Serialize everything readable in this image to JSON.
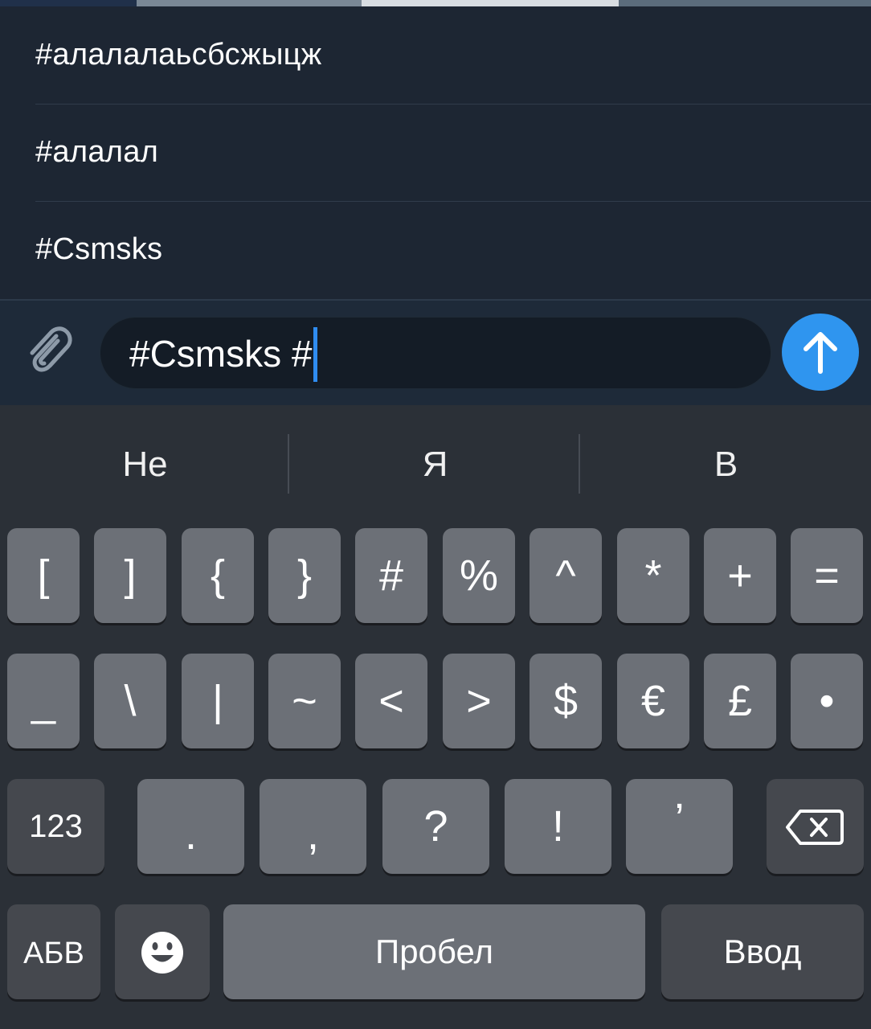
{
  "suggestions": [
    "#алалалаьсбсжыцж",
    "#алалал",
    "#Csmsks"
  ],
  "compose": {
    "input_value": "#Csmsks #",
    "attach_icon": "paperclip-icon",
    "send_icon": "arrow-up-icon",
    "accent_color": "#2f95ef"
  },
  "keyboard": {
    "predictions": [
      "Не",
      "Я",
      "В"
    ],
    "row1": [
      "[",
      "]",
      "{",
      "}",
      "#",
      "%",
      "^",
      "*",
      "+",
      "="
    ],
    "row2": [
      "_",
      "\\",
      "|",
      "~",
      "<",
      ">",
      "$",
      "€",
      "£",
      "•"
    ],
    "row3": {
      "mode": "123",
      "keys": [
        ".",
        ",",
        "?",
        "!",
        "’"
      ],
      "backspace_icon": "backspace-icon"
    },
    "row4": {
      "alpha": "АБВ",
      "emoji_icon": "emoji-icon",
      "space": "Пробел",
      "return": "Ввод"
    }
  }
}
